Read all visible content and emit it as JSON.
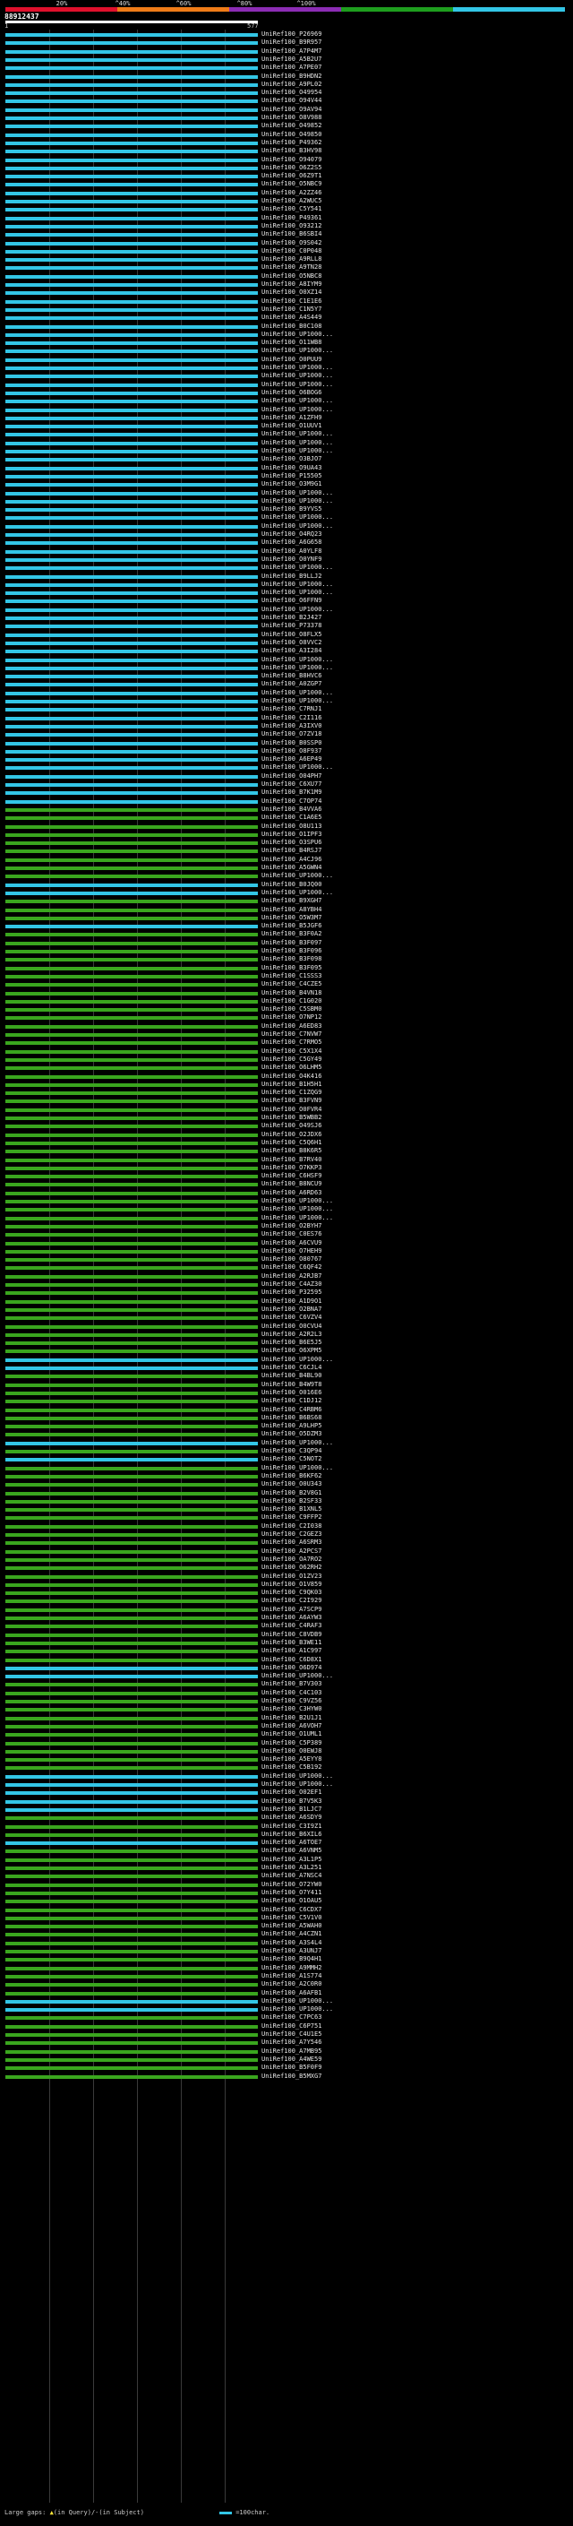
{
  "title": "88912437",
  "legend": {
    "labels": [
      "20%",
      "^40%",
      "^60%",
      "^80%",
      "^100%"
    ],
    "colors": [
      "#e0102c",
      "#f07c18",
      "#8c2cb4",
      "#1e9e1e",
      "#33c6e6"
    ]
  },
  "ruler": {
    "start": "1",
    "end": "577"
  },
  "query_length": 577,
  "footer": {
    "gaps_label": "Large gaps:",
    "gap_in_query": "(in Query)/",
    "gap_in_subject": "(in Subject)",
    "scale_label": "=100char."
  },
  "colors": {
    "cyan": "#33c6e6",
    "green": "#3aa61e",
    "background": "#000000"
  },
  "hits": [
    {
      "id": "UniRef100_P26969",
      "color": "cyan"
    },
    {
      "id": "UniRef100_B9R957",
      "color": "cyan"
    },
    {
      "id": "UniRef100_A7P4M7",
      "color": "cyan"
    },
    {
      "id": "UniRef100_A5B2U7",
      "color": "cyan"
    },
    {
      "id": "UniRef100_A7PE07",
      "color": "cyan"
    },
    {
      "id": "UniRef100_B9HDN2",
      "color": "cyan"
    },
    {
      "id": "UniRef100_A9PL02",
      "color": "cyan"
    },
    {
      "id": "UniRef100_O49954",
      "color": "cyan"
    },
    {
      "id": "UniRef100_O94V44",
      "color": "cyan"
    },
    {
      "id": "UniRef100_O9AV94",
      "color": "cyan"
    },
    {
      "id": "UniRef100_O8V988",
      "color": "cyan"
    },
    {
      "id": "UniRef100_O49852",
      "color": "cyan"
    },
    {
      "id": "UniRef100_O49850",
      "color": "cyan"
    },
    {
      "id": "UniRef100_P49362",
      "color": "cyan"
    },
    {
      "id": "UniRef100_B3HV98",
      "color": "cyan"
    },
    {
      "id": "UniRef100_O94079",
      "color": "cyan"
    },
    {
      "id": "UniRef100_O6Z2S5",
      "color": "cyan"
    },
    {
      "id": "UniRef100_O6Z9T1",
      "color": "cyan"
    },
    {
      "id": "UniRef100_O5NBC9",
      "color": "cyan"
    },
    {
      "id": "UniRef100_A2ZZ46",
      "color": "cyan"
    },
    {
      "id": "UniRef100_A2WUC5",
      "color": "cyan"
    },
    {
      "id": "UniRef100_C5Y541",
      "color": "cyan"
    },
    {
      "id": "UniRef100_P49361",
      "color": "cyan"
    },
    {
      "id": "UniRef100_O93212",
      "color": "cyan"
    },
    {
      "id": "UniRef100_B6SBI4",
      "color": "cyan"
    },
    {
      "id": "UniRef100_O9S042",
      "color": "cyan"
    },
    {
      "id": "UniRef100_C0P048",
      "color": "cyan"
    },
    {
      "id": "UniRef100_A9RLL8",
      "color": "cyan"
    },
    {
      "id": "UniRef100_A9TN28",
      "color": "cyan"
    },
    {
      "id": "UniRef100_O5NBC8",
      "color": "cyan"
    },
    {
      "id": "UniRef100_A8IYM9",
      "color": "cyan"
    },
    {
      "id": "UniRef100_O0XZ14",
      "color": "cyan"
    },
    {
      "id": "UniRef100_C1E1E6",
      "color": "cyan"
    },
    {
      "id": "UniRef100_C1N5Y7",
      "color": "cyan"
    },
    {
      "id": "UniRef100_A4S449",
      "color": "cyan"
    },
    {
      "id": "UniRef100_B0C108",
      "color": "cyan"
    },
    {
      "id": "UniRef100_UP1000...",
      "color": "cyan"
    },
    {
      "id": "UniRef100_O11WB8",
      "color": "cyan"
    },
    {
      "id": "UniRef100_UP1000...",
      "color": "cyan"
    },
    {
      "id": "UniRef100_O0PUU9",
      "color": "cyan"
    },
    {
      "id": "UniRef100_UP1000...",
      "color": "cyan"
    },
    {
      "id": "UniRef100_UP1000...",
      "color": "cyan"
    },
    {
      "id": "UniRef100_UP1000...",
      "color": "cyan"
    },
    {
      "id": "UniRef100_O6BOG6",
      "color": "cyan"
    },
    {
      "id": "UniRef100_UP1000...",
      "color": "cyan"
    },
    {
      "id": "UniRef100_UP1000...",
      "color": "cyan"
    },
    {
      "id": "UniRef100_A1ZFH9",
      "color": "cyan"
    },
    {
      "id": "UniRef100_O1UUV1",
      "color": "cyan"
    },
    {
      "id": "UniRef100_UP1000...",
      "color": "cyan"
    },
    {
      "id": "UniRef100_UP1000...",
      "color": "cyan"
    },
    {
      "id": "UniRef100_UP1000...",
      "color": "cyan"
    },
    {
      "id": "UniRef100_O3BJO7",
      "color": "cyan"
    },
    {
      "id": "UniRef100_O9UA43",
      "color": "cyan"
    },
    {
      "id": "UniRef100_P15505",
      "color": "cyan"
    },
    {
      "id": "UniRef100_O3M9G1",
      "color": "cyan"
    },
    {
      "id": "UniRef100_UP1000...",
      "color": "cyan"
    },
    {
      "id": "UniRef100_UP1000...",
      "color": "cyan"
    },
    {
      "id": "UniRef100_B9YVS5",
      "color": "cyan"
    },
    {
      "id": "UniRef100_UP1000...",
      "color": "cyan"
    },
    {
      "id": "UniRef100_UP1000...",
      "color": "cyan"
    },
    {
      "id": "UniRef100_O4RQ23",
      "color": "cyan"
    },
    {
      "id": "UniRef100_A6G658",
      "color": "cyan"
    },
    {
      "id": "UniRef100_A0YLF8",
      "color": "cyan"
    },
    {
      "id": "UniRef100_O0YNF9",
      "color": "cyan"
    },
    {
      "id": "UniRef100_UP1000...",
      "color": "cyan"
    },
    {
      "id": "UniRef100_B9LLJ2",
      "color": "cyan"
    },
    {
      "id": "UniRef100_UP1000...",
      "color": "cyan"
    },
    {
      "id": "UniRef100_UP1000...",
      "color": "cyan"
    },
    {
      "id": "UniRef100_O6FFN9",
      "color": "cyan"
    },
    {
      "id": "UniRef100_UP1000...",
      "color": "cyan"
    },
    {
      "id": "UniRef100_B2J427",
      "color": "cyan"
    },
    {
      "id": "UniRef100_P73378",
      "color": "cyan"
    },
    {
      "id": "UniRef100_O8FLX5",
      "color": "cyan"
    },
    {
      "id": "UniRef100_O8VVC2",
      "color": "cyan"
    },
    {
      "id": "UniRef100_A3I284",
      "color": "cyan"
    },
    {
      "id": "UniRef100_UP1000...",
      "color": "cyan"
    },
    {
      "id": "UniRef100_UP1000...",
      "color": "cyan"
    },
    {
      "id": "UniRef100_B8HVC6",
      "color": "cyan"
    },
    {
      "id": "UniRef100_A0ZGP7",
      "color": "cyan"
    },
    {
      "id": "UniRef100_UP1000...",
      "color": "cyan"
    },
    {
      "id": "UniRef100_UP1000...",
      "color": "cyan"
    },
    {
      "id": "UniRef100_C7RNJ1",
      "color": "cyan"
    },
    {
      "id": "UniRef100_C2I116",
      "color": "cyan"
    },
    {
      "id": "UniRef100_A3IXV0",
      "color": "cyan"
    },
    {
      "id": "UniRef100_O7ZV18",
      "color": "cyan"
    },
    {
      "id": "UniRef100_B0SSP0",
      "color": "cyan"
    },
    {
      "id": "UniRef100_O8F937",
      "color": "cyan"
    },
    {
      "id": "UniRef100_A6EP49",
      "color": "cyan"
    },
    {
      "id": "UniRef100_UP1000...",
      "color": "cyan"
    },
    {
      "id": "UniRef100_O04PH7",
      "color": "cyan"
    },
    {
      "id": "UniRef100_C6XU77",
      "color": "cyan"
    },
    {
      "id": "UniRef100_B7K1M9",
      "color": "cyan"
    },
    {
      "id": "UniRef100_C7OP74",
      "color": "cyan"
    },
    {
      "id": "UniRef100_B4VVA6",
      "color": "green"
    },
    {
      "id": "UniRef100_C1A6E5",
      "color": "green"
    },
    {
      "id": "UniRef100_O8U113",
      "color": "green"
    },
    {
      "id": "UniRef100_O1IPF3",
      "color": "green"
    },
    {
      "id": "UniRef100_O3SPU6",
      "color": "green"
    },
    {
      "id": "UniRef100_B4RSJ7",
      "color": "green"
    },
    {
      "id": "UniRef100_A4CJ96",
      "color": "green"
    },
    {
      "id": "UniRef100_A5GWN4",
      "color": "green"
    },
    {
      "id": "UniRef100_UP1000...",
      "color": "green"
    },
    {
      "id": "UniRef100_B0JQ00",
      "color": "cyan"
    },
    {
      "id": "UniRef100_UP1000...",
      "color": "cyan"
    },
    {
      "id": "UniRef100_B9XGH7",
      "color": "green"
    },
    {
      "id": "UniRef100_A8YBH4",
      "color": "green"
    },
    {
      "id": "UniRef100_O5W3M7",
      "color": "green"
    },
    {
      "id": "UniRef100_B5JGF6",
      "color": "cyan"
    },
    {
      "id": "UniRef100_B3F0A2",
      "color": "green"
    },
    {
      "id": "UniRef100_B3F097",
      "color": "green"
    },
    {
      "id": "UniRef100_B3F096",
      "color": "green"
    },
    {
      "id": "UniRef100_B3F098",
      "color": "green"
    },
    {
      "id": "UniRef100_B3F095",
      "color": "green"
    },
    {
      "id": "UniRef100_C1SSS3",
      "color": "green"
    },
    {
      "id": "UniRef100_C4CZE5",
      "color": "green"
    },
    {
      "id": "UniRef100_B4VN18",
      "color": "green"
    },
    {
      "id": "UniRef100_C1G020",
      "color": "green"
    },
    {
      "id": "UniRef100_C5SBM0",
      "color": "green"
    },
    {
      "id": "UniRef100_O7NP12",
      "color": "green"
    },
    {
      "id": "UniRef100_A6ED83",
      "color": "green"
    },
    {
      "id": "UniRef100_C7NVW7",
      "color": "green"
    },
    {
      "id": "UniRef100_C7RMO5",
      "color": "green"
    },
    {
      "id": "UniRef100_C5X1X4",
      "color": "green"
    },
    {
      "id": "UniRef100_C5GY49",
      "color": "green"
    },
    {
      "id": "UniRef100_O6LHM5",
      "color": "green"
    },
    {
      "id": "UniRef100_O4K416",
      "color": "green"
    },
    {
      "id": "UniRef100_B1H5H1",
      "color": "green"
    },
    {
      "id": "UniRef100_C1ZQG9",
      "color": "green"
    },
    {
      "id": "UniRef100_B3FVN9",
      "color": "green"
    },
    {
      "id": "UniRef100_O0FVR4",
      "color": "green"
    },
    {
      "id": "UniRef100_B5WBB2",
      "color": "green"
    },
    {
      "id": "UniRef100_O49SJ6",
      "color": "green"
    },
    {
      "id": "UniRef100_O2JDX6",
      "color": "green"
    },
    {
      "id": "UniRef100_C5Q6H1",
      "color": "green"
    },
    {
      "id": "UniRef100_B8K6R5",
      "color": "green"
    },
    {
      "id": "UniRef100_B7RV40",
      "color": "green"
    },
    {
      "id": "UniRef100_O7KKP3",
      "color": "green"
    },
    {
      "id": "UniRef100_C6HSF9",
      "color": "green"
    },
    {
      "id": "UniRef100_B8NCU9",
      "color": "green"
    },
    {
      "id": "UniRef100_A6RD63",
      "color": "green"
    },
    {
      "id": "UniRef100_UP1000...",
      "color": "green"
    },
    {
      "id": "UniRef100_UP1000...",
      "color": "green"
    },
    {
      "id": "UniRef100_UP1000...",
      "color": "green"
    },
    {
      "id": "UniRef100_O2BYH7",
      "color": "green"
    },
    {
      "id": "UniRef100_C0ES76",
      "color": "green"
    },
    {
      "id": "UniRef100_A6CVU9",
      "color": "green"
    },
    {
      "id": "UniRef100_O7HEH9",
      "color": "green"
    },
    {
      "id": "UniRef100_O80767",
      "color": "green"
    },
    {
      "id": "UniRef100_C6QF42",
      "color": "green"
    },
    {
      "id": "UniRef100_A2RJB7",
      "color": "green"
    },
    {
      "id": "UniRef100_C4AZ30",
      "color": "green"
    },
    {
      "id": "UniRef100_P32595",
      "color": "green"
    },
    {
      "id": "UniRef100_A1D9O1",
      "color": "green"
    },
    {
      "id": "UniRef100_O2BNA7",
      "color": "green"
    },
    {
      "id": "UniRef100_C6VZV4",
      "color": "green"
    },
    {
      "id": "UniRef100_O0CVU4",
      "color": "green"
    },
    {
      "id": "UniRef100_A2R2L3",
      "color": "green"
    },
    {
      "id": "UniRef100_B6E5J5",
      "color": "green"
    },
    {
      "id": "UniRef100_O6XPM5",
      "color": "green"
    },
    {
      "id": "UniRef100_UP1000...",
      "color": "cyan"
    },
    {
      "id": "UniRef100_C6CJL4",
      "color": "cyan"
    },
    {
      "id": "UniRef100_B4BL90",
      "color": "green"
    },
    {
      "id": "UniRef100_B4W9T8",
      "color": "green"
    },
    {
      "id": "UniRef100_O016E6",
      "color": "green"
    },
    {
      "id": "UniRef100_C1DJ12",
      "color": "green"
    },
    {
      "id": "UniRef100_C4RBM6",
      "color": "green"
    },
    {
      "id": "UniRef100_B6BS68",
      "color": "green"
    },
    {
      "id": "UniRef100_A9LHP5",
      "color": "green"
    },
    {
      "id": "UniRef100_O5DZM3",
      "color": "green"
    },
    {
      "id": "UniRef100_UP1000...",
      "color": "cyan"
    },
    {
      "id": "UniRef100_C3QP94",
      "color": "green"
    },
    {
      "id": "UniRef100_C5NOT2",
      "color": "cyan"
    },
    {
      "id": "UniRef100_UP1000...",
      "color": "green"
    },
    {
      "id": "UniRef100_B6KF62",
      "color": "green"
    },
    {
      "id": "UniRef100_O0U343",
      "color": "green"
    },
    {
      "id": "UniRef100_B2V8G1",
      "color": "green"
    },
    {
      "id": "UniRef100_B2SF33",
      "color": "green"
    },
    {
      "id": "UniRef100_B1XNL5",
      "color": "green"
    },
    {
      "id": "UniRef100_C9FFP2",
      "color": "green"
    },
    {
      "id": "UniRef100_C2I038",
      "color": "green"
    },
    {
      "id": "UniRef100_C2GEZ3",
      "color": "green"
    },
    {
      "id": "UniRef100_A6SRM3",
      "color": "green"
    },
    {
      "id": "UniRef100_A2PCS7",
      "color": "green"
    },
    {
      "id": "UniRef100_OA7RO2",
      "color": "green"
    },
    {
      "id": "UniRef100_O62RH2",
      "color": "green"
    },
    {
      "id": "UniRef100_O1ZV23",
      "color": "green"
    },
    {
      "id": "UniRef100_O1V859",
      "color": "green"
    },
    {
      "id": "UniRef100_C9QK03",
      "color": "green"
    },
    {
      "id": "UniRef100_C2I929",
      "color": "green"
    },
    {
      "id": "UniRef100_A7SCP9",
      "color": "green"
    },
    {
      "id": "UniRef100_A6AYW3",
      "color": "green"
    },
    {
      "id": "UniRef100_C4RAF3",
      "color": "green"
    },
    {
      "id": "UniRef100_C8VDB9",
      "color": "green"
    },
    {
      "id": "UniRef100_B3WE11",
      "color": "green"
    },
    {
      "id": "UniRef100_A1C997",
      "color": "green"
    },
    {
      "id": "UniRef100_C6D8X1",
      "color": "green"
    },
    {
      "id": "UniRef100_O6D974",
      "color": "cyan"
    },
    {
      "id": "UniRef100_UP1000...",
      "color": "cyan"
    },
    {
      "id": "UniRef100_B7V303",
      "color": "green"
    },
    {
      "id": "UniRef100_C4C103",
      "color": "green"
    },
    {
      "id": "UniRef100_C9VZ56",
      "color": "green"
    },
    {
      "id": "UniRef100_C3HYW0",
      "color": "green"
    },
    {
      "id": "UniRef100_B2U1J1",
      "color": "green"
    },
    {
      "id": "UniRef100_A6VOH7",
      "color": "green"
    },
    {
      "id": "UniRef100_O1UML1",
      "color": "green"
    },
    {
      "id": "UniRef100_C5P389",
      "color": "green"
    },
    {
      "id": "UniRef100_O0EWJ8",
      "color": "green"
    },
    {
      "id": "UniRef100_A5EYY8",
      "color": "green"
    },
    {
      "id": "UniRef100_C5B192",
      "color": "green"
    },
    {
      "id": "UniRef100_UP1000...",
      "color": "cyan"
    },
    {
      "id": "UniRef100_UP1000...",
      "color": "cyan"
    },
    {
      "id": "UniRef100_O02EF1",
      "color": "cyan"
    },
    {
      "id": "UniRef100_B7V5K3",
      "color": "cyan"
    },
    {
      "id": "UniRef100_B1LJC7",
      "color": "cyan"
    },
    {
      "id": "UniRef100_A6SDY9",
      "color": "green"
    },
    {
      "id": "UniRef100_C3I9Z1",
      "color": "green"
    },
    {
      "id": "UniRef100_B6XIL6",
      "color": "green"
    },
    {
      "id": "UniRef100_A6TOE7",
      "color": "cyan"
    },
    {
      "id": "UniRef100_A6VNM5",
      "color": "green"
    },
    {
      "id": "UniRef100_A3L1P5",
      "color": "green"
    },
    {
      "id": "UniRef100_A3L251",
      "color": "green"
    },
    {
      "id": "UniRef100_A7NSC4",
      "color": "green"
    },
    {
      "id": "UniRef100_O72YW0",
      "color": "green"
    },
    {
      "id": "UniRef100_O7Y411",
      "color": "green"
    },
    {
      "id": "UniRef100_O1OAU5",
      "color": "green"
    },
    {
      "id": "UniRef100_C6CDX7",
      "color": "green"
    },
    {
      "id": "UniRef100_C5V1V0",
      "color": "green"
    },
    {
      "id": "UniRef100_A5WAH0",
      "color": "green"
    },
    {
      "id": "UniRef100_A4CZN1",
      "color": "green"
    },
    {
      "id": "UniRef100_A3S4L4",
      "color": "green"
    },
    {
      "id": "UniRef100_A3UNJ7",
      "color": "green"
    },
    {
      "id": "UniRef100_B9Q4H1",
      "color": "green"
    },
    {
      "id": "UniRef100_A9MMH2",
      "color": "green"
    },
    {
      "id": "UniRef100_A1S774",
      "color": "green"
    },
    {
      "id": "UniRef100_A2C0R0",
      "color": "green"
    },
    {
      "id": "UniRef100_A6AFB1",
      "color": "green"
    },
    {
      "id": "UniRef100_UP1000...",
      "color": "cyan"
    },
    {
      "id": "UniRef100_UP1000...",
      "color": "cyan"
    },
    {
      "id": "UniRef100_C7PC63",
      "color": "green"
    },
    {
      "id": "UniRef100_C6P751",
      "color": "green"
    },
    {
      "id": "UniRef100_C4U1E5",
      "color": "green"
    },
    {
      "id": "UniRef100_A7Y546",
      "color": "green"
    },
    {
      "id": "UniRef100_A7MB95",
      "color": "green"
    },
    {
      "id": "UniRef100_A4WE59",
      "color": "green"
    },
    {
      "id": "UniRef100_B5F0F9",
      "color": "green"
    },
    {
      "id": "UniRef100_B5MXG7",
      "color": "green"
    }
  ]
}
